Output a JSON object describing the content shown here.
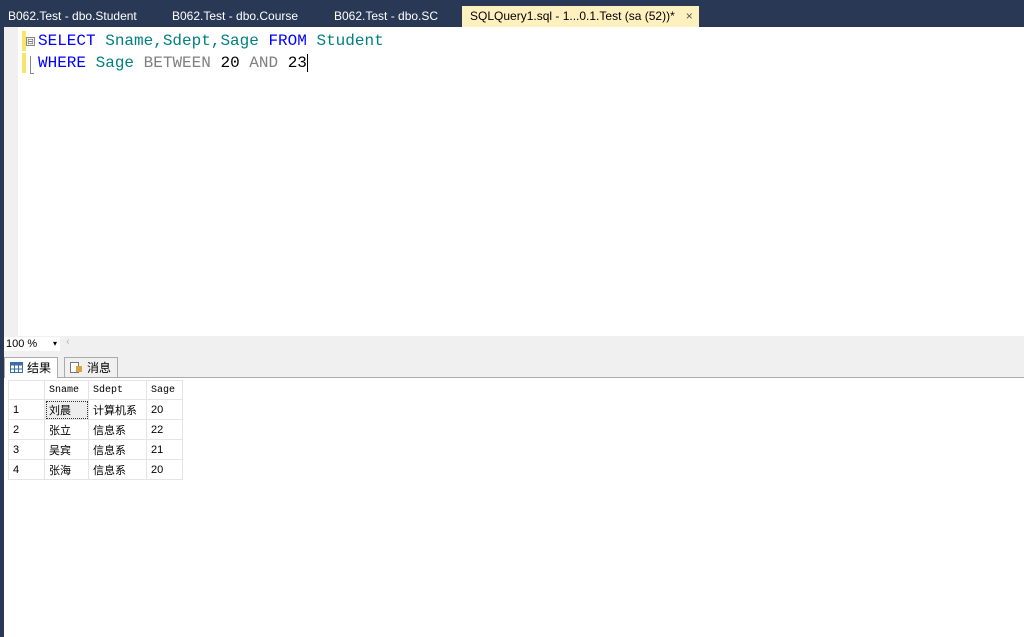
{
  "tabs": [
    {
      "label": "B062.Test - dbo.Student"
    },
    {
      "label": "B062.Test - dbo.Course"
    },
    {
      "label": "B062.Test - dbo.SC"
    },
    {
      "label": "SQLQuery1.sql - 1...0.1.Test (sa (52))*",
      "active": true,
      "close": "×"
    }
  ],
  "editor": {
    "line1": {
      "select": "SELECT",
      "cols": "Sname,Sdept,Sage",
      "from": "FROM",
      "table": "Student"
    },
    "line2": {
      "where": "WHERE",
      "col": "Sage",
      "between": "BETWEEN",
      "low": "20",
      "and": "AND",
      "high": "23"
    },
    "fold": "⊟"
  },
  "zoom": {
    "value": "100 %",
    "arrow": "▾",
    "scroll_left": "‹"
  },
  "result_tabs": [
    {
      "label": "结果"
    },
    {
      "label": "消息"
    }
  ],
  "grid": {
    "columns": [
      "Sname",
      "Sdept",
      "Sage"
    ],
    "rows": [
      {
        "n": "1",
        "Sname": "刘晨",
        "Sdept": "计算机系",
        "Sage": "20"
      },
      {
        "n": "2",
        "Sname": "张立",
        "Sdept": "信息系",
        "Sage": "22"
      },
      {
        "n": "3",
        "Sname": "吴宾",
        "Sdept": "信息系",
        "Sage": "21"
      },
      {
        "n": "4",
        "Sname": "张海",
        "Sdept": "信息系",
        "Sage": "20"
      }
    ]
  }
}
